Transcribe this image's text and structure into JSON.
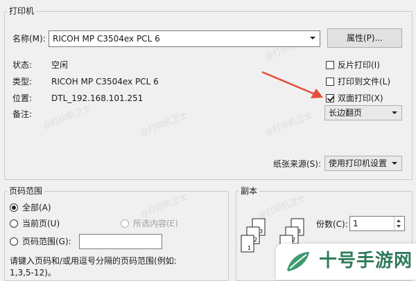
{
  "printer_group": {
    "legend": "打印机",
    "name_label": "名称(M):",
    "name_value": "RICOH MP C3504ex PCL 6",
    "properties_button": "属性(P)...",
    "status_label": "状态:",
    "status_value": "空闲",
    "type_label": "类型:",
    "type_value": "RICOH MP C3504ex PCL 6",
    "location_label": "位置:",
    "location_value": "DTL_192.168.101.251",
    "comment_label": "备注:",
    "reverse_print": {
      "label": "反片打印(I)",
      "checked": false
    },
    "print_to_file": {
      "label": "打印到文件(L)",
      "checked": false
    },
    "duplex": {
      "label": "双面打印(X)",
      "checked": true
    },
    "duplex_mode": "长边翻页",
    "paper_source_label": "纸张来源(S):",
    "paper_source_value": "使用打印机设置"
  },
  "page_range": {
    "legend": "页码范围",
    "all": "全部(A)",
    "current": "当前页(U)",
    "selection": "所选内容(E)",
    "pages": "页码范围(G):",
    "pages_value": "",
    "hint_line1": "请键入页码和/或用逗号分隔的页码范围(例如:",
    "hint_line2": "1,3,5-12)。",
    "selected": "all"
  },
  "copies": {
    "legend": "副本",
    "count_label": "份数(C):",
    "count_value": "1"
  },
  "watermark": {
    "text": "@打印机卫士"
  },
  "branding": {
    "text": "十号手游网",
    "color": "#2f7a5a"
  },
  "annotation": {
    "arrow_color": "#e84c3d"
  },
  "icons": [
    "checkbox-icon",
    "radio-icon",
    "dropdown-arrow-icon",
    "spinner-up-icon",
    "spinner-down-icon",
    "collate-pages-icon",
    "uncollate-pages-icon",
    "logo-leaf-icon",
    "red-arrow-icon"
  ]
}
